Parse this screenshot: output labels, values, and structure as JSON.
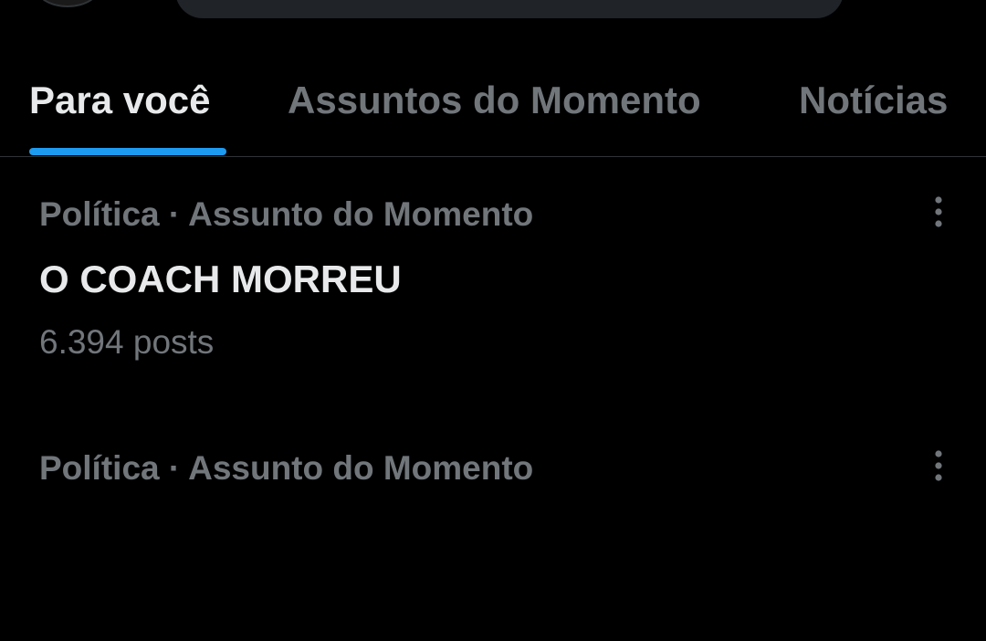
{
  "tabs": [
    {
      "label": "Para você",
      "active": true
    },
    {
      "label": "Assuntos do Momento",
      "active": false
    },
    {
      "label": "Notícias",
      "active": false
    }
  ],
  "trends": [
    {
      "meta": "Política · Assunto do Momento",
      "title": "O COACH MORREU",
      "count": "6.394 posts",
      "more_icon": "more-vertical-icon"
    },
    {
      "meta": "Política · Assunto do Momento",
      "more_icon": "more-vertical-icon"
    }
  ],
  "colors": {
    "background": "#000000",
    "primary_text": "#e7e9ea",
    "secondary_text": "#71767b",
    "accent": "#1d9bf0",
    "divider": "#2f3336"
  }
}
